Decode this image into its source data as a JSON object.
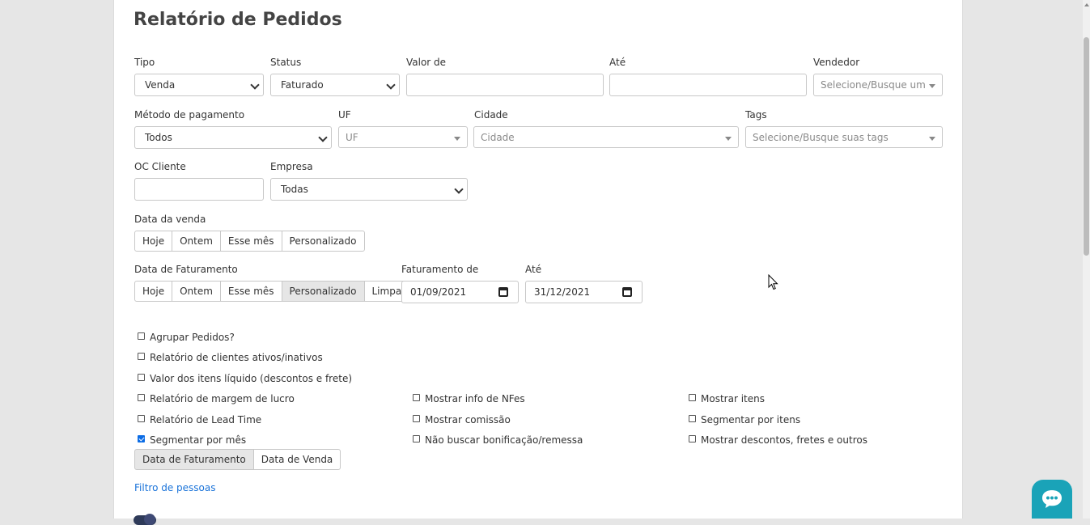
{
  "page": {
    "title": "Relatório de Pedidos"
  },
  "filters": {
    "tipo": {
      "label": "Tipo",
      "value": "Venda"
    },
    "status": {
      "label": "Status",
      "value": "Faturado"
    },
    "valor_de": {
      "label": "Valor de",
      "value": ""
    },
    "ate": {
      "label": "Até",
      "value": ""
    },
    "vendedor": {
      "label": "Vendedor",
      "placeholder": "Selecione/Busque um vei"
    },
    "metodo_pagamento": {
      "label": "Método de pagamento",
      "value": "Todos"
    },
    "uf": {
      "label": "UF",
      "placeholder": "UF"
    },
    "cidade": {
      "label": "Cidade",
      "placeholder": "Cidade"
    },
    "tags": {
      "label": "Tags",
      "placeholder": "Selecione/Busque suas tags"
    },
    "oc_cliente": {
      "label": "OC Cliente",
      "value": ""
    },
    "empresa": {
      "label": "Empresa",
      "value": "Todas"
    }
  },
  "data_venda": {
    "label": "Data da venda",
    "buttons": [
      "Hoje",
      "Ontem",
      "Esse mês",
      "Personalizado"
    ]
  },
  "data_faturamento": {
    "label": "Data de Faturamento",
    "buttons": [
      "Hoje",
      "Ontem",
      "Esse mês",
      "Personalizado",
      "Limpar"
    ],
    "active": "Personalizado",
    "from_label": "Faturamento de",
    "from_value": "01/09/2021",
    "to_label": "Até",
    "to_value": "31/12/2021"
  },
  "options": {
    "agrupar": "Agrupar Pedidos?",
    "clientes_ativos": "Relatório de clientes ativos/inativos",
    "valor_liquido": "Valor dos itens líquido (descontos e frete)",
    "margem_lucro": "Relatório de margem de lucro",
    "info_nfes": "Mostrar info de NFes",
    "mostrar_itens": "Mostrar itens",
    "lead_time": "Relatório de Lead Time",
    "comissao": "Mostrar comissão",
    "segmentar_itens": "Segmentar por itens",
    "segmentar_mes": "Segmentar por mês",
    "bonificacao": "Não buscar bonificação/remessa",
    "descontos_fretes": "Mostrar descontos, fretes e outros"
  },
  "segment_buttons": [
    "Data de Faturamento",
    "Data de Venda"
  ],
  "segment_active": "Data de Faturamento",
  "filtro_pessoas": "Filtro de pessoas",
  "colors": {
    "accent": "#1a73d9",
    "chat": "#1aa3b8",
    "checkbox": "#0b6ce5"
  }
}
